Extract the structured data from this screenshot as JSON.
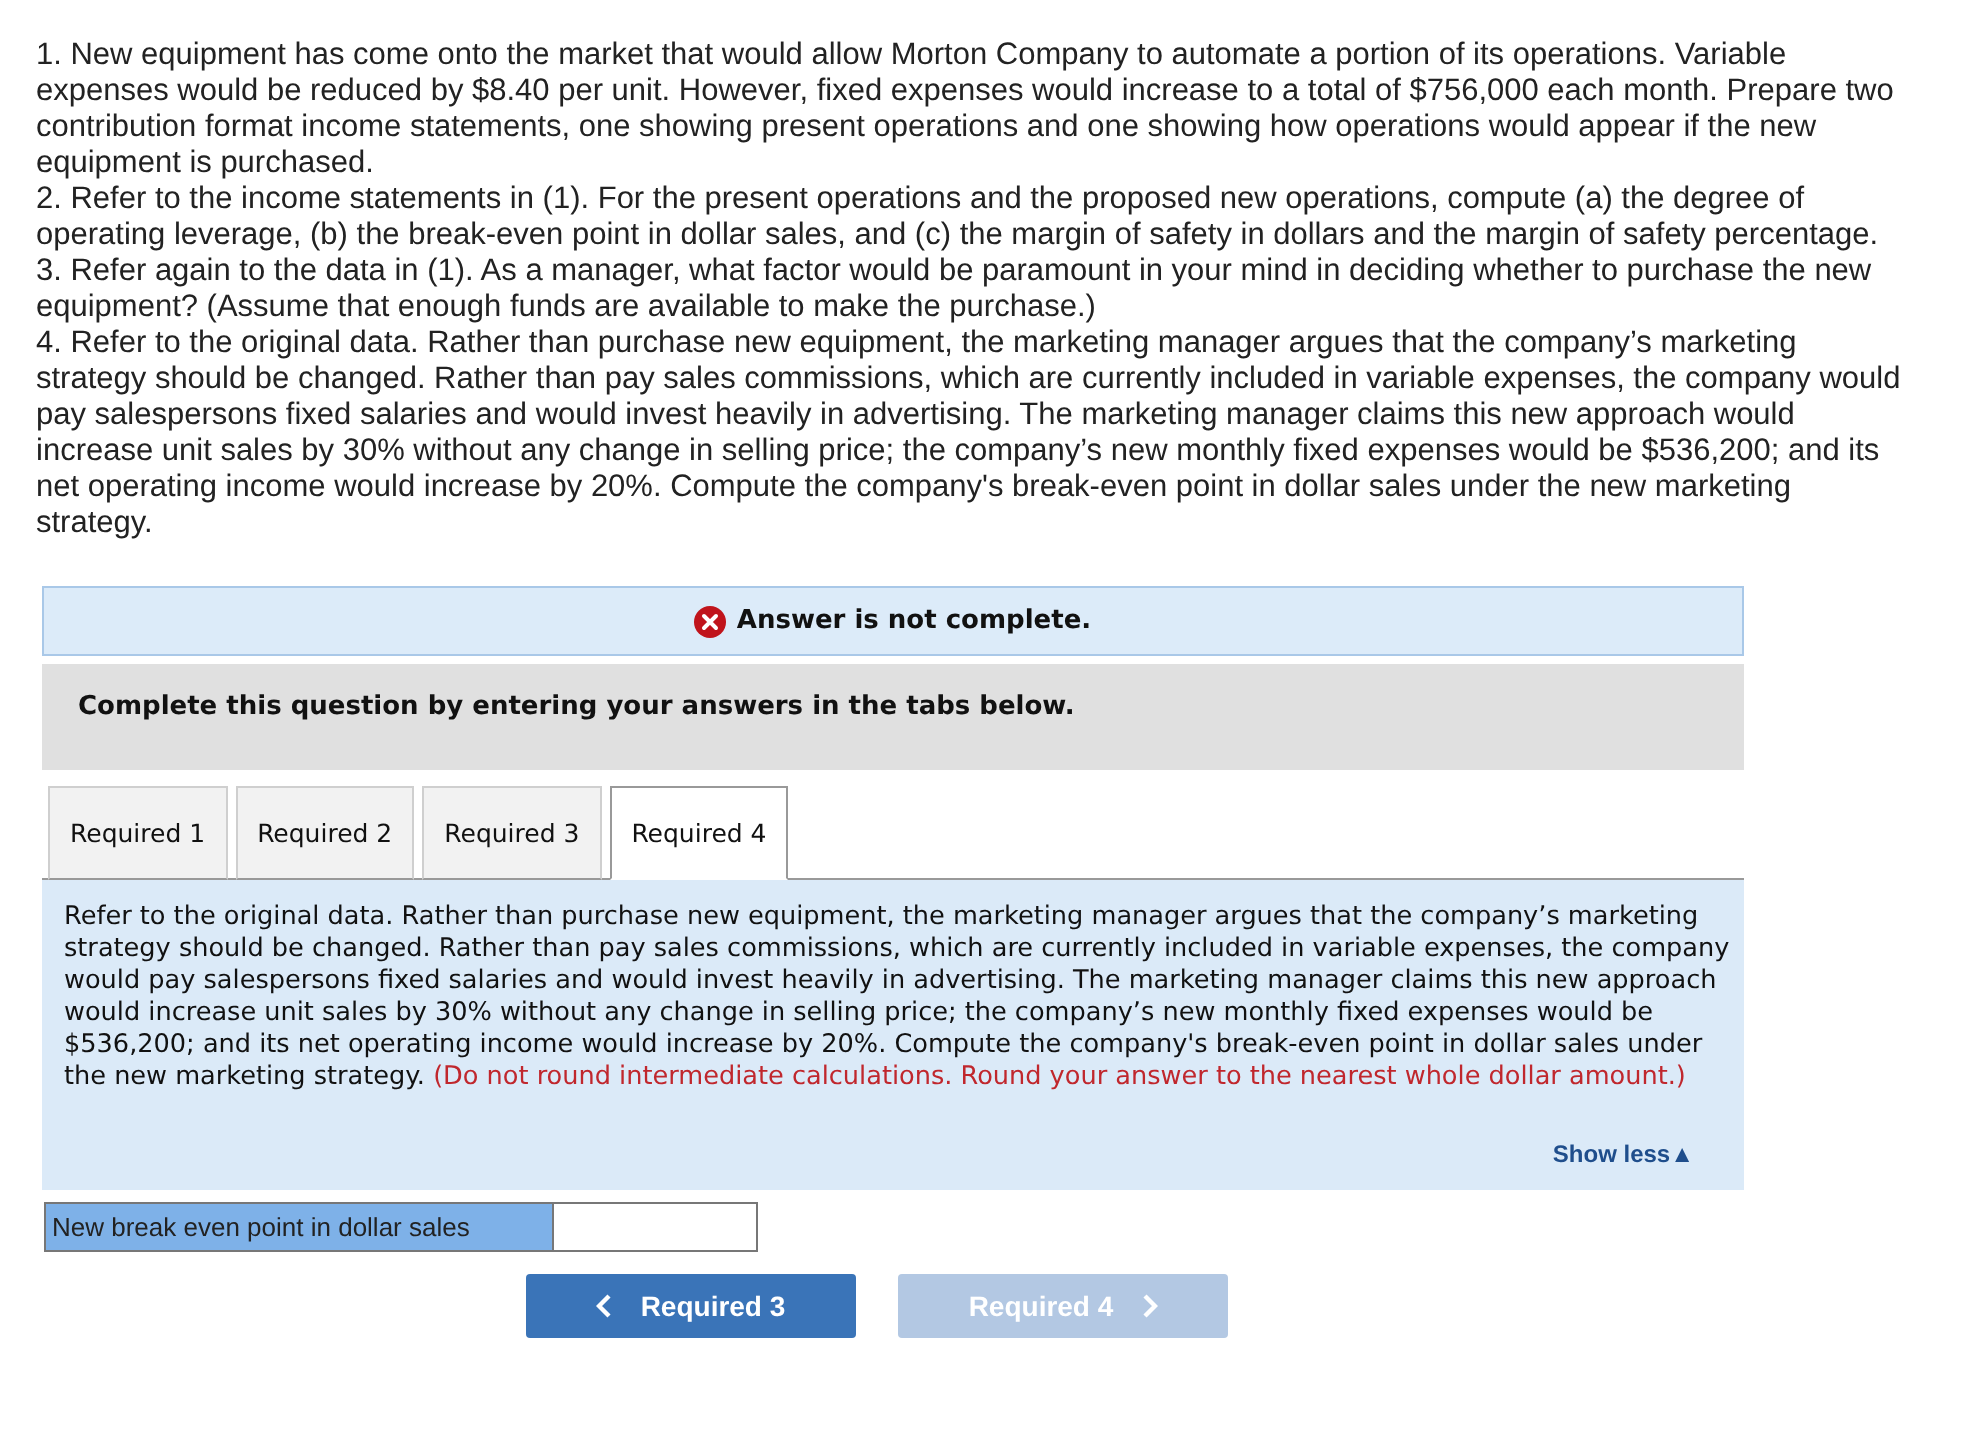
{
  "question": {
    "paragraphs": [
      "1. New equipment has come onto the market that would allow Morton Company to automate a portion of its operations. Variable expenses would be reduced by $8.40 per unit. However, fixed expenses would increase to a total of $756,000 each month. Prepare two contribution format income statements, one showing present operations and one showing how operations would appear if the new equipment is purchased.",
      "2. Refer to the income statements in (1). For the present operations and the proposed new operations, compute (a) the degree of operating leverage, (b) the break-even point in dollar sales, and (c) the margin of safety in dollars and the margin of safety percentage.",
      "3. Refer again to the data in (1). As a manager, what factor would be paramount in your mind in deciding whether to purchase the new equipment? (Assume that enough funds are available to make the purchase.)",
      "4. Refer to the original data. Rather than purchase new equipment, the marketing manager argues that the company’s marketing strategy should be changed. Rather than pay sales commissions, which are currently included in variable expenses, the company would pay salespersons fixed salaries and would invest heavily in advertising. The marketing manager claims this new approach would increase unit sales by 30% without any change in selling price; the company’s new monthly fixed expenses would be $536,200; and its net operating income would increase by 20%. Compute the company's break-even point in dollar sales under the new marketing strategy."
    ]
  },
  "alert": {
    "text": "Answer is not complete."
  },
  "instruction": "Complete this question by entering your answers in the tabs below.",
  "tabs": [
    {
      "label": "Required 1",
      "selected": false
    },
    {
      "label": "Required 2",
      "selected": false
    },
    {
      "label": "Required 3",
      "selected": false
    },
    {
      "label": "Required 4",
      "selected": true
    }
  ],
  "panel": {
    "text": "Refer to the original data. Rather than purchase new equipment, the marketing manager argues that the company’s marketing strategy should be changed. Rather than pay sales commissions, which are currently included in variable expenses, the company would pay salespersons fixed salaries and would invest heavily in advertising. The marketing manager claims this new approach would increase unit sales by 30% without any change in selling price; the company’s new monthly fixed expenses would be $536,200; and its net operating income would increase by 20%. Compute the company's break-even point in dollar sales under the new marketing strategy.",
    "note": "(Do not round intermediate calculations. Round your answer to the nearest whole dollar amount.)",
    "toggle": "Show less▲"
  },
  "answer": {
    "label": "New break even point in dollar sales"
  },
  "nav_buttons": [
    {
      "kind": "previous",
      "label": "Required 3",
      "disabled": false
    },
    {
      "kind": "next",
      "label": "Required 4",
      "disabled": true
    }
  ]
}
